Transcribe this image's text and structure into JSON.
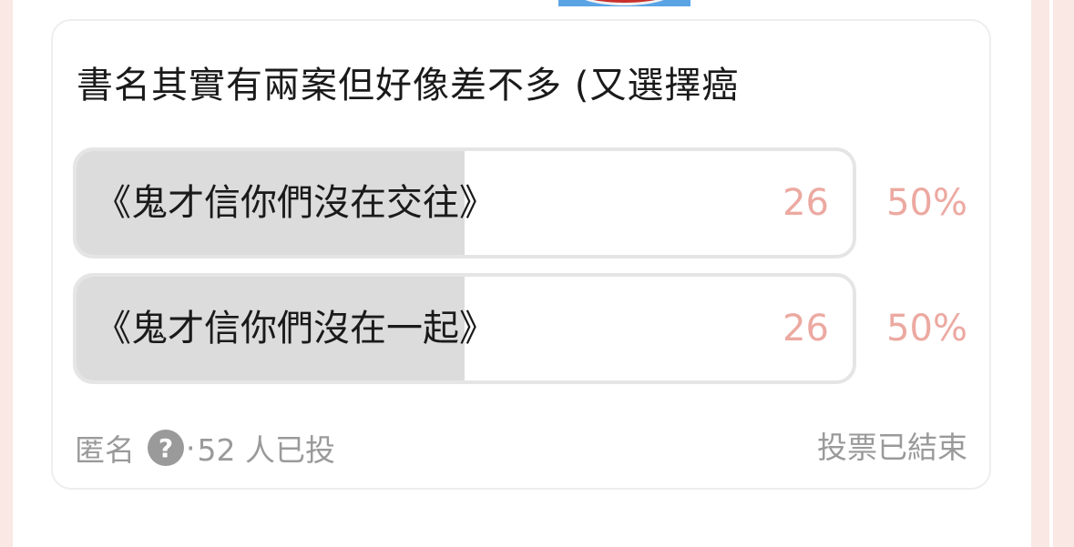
{
  "poll": {
    "question": "書名其實有兩案但好像差不多 (又選擇癌",
    "options": [
      {
        "label": "《鬼才信你們沒在交往》",
        "votes": "26",
        "percent": "50%",
        "fraction": 0.5
      },
      {
        "label": "《鬼才信你們沒在一起》",
        "votes": "26",
        "percent": "50%",
        "fraction": 0.5
      }
    ],
    "footer": {
      "anonymous_label": "匿名",
      "help_icon": "question-mark-icon",
      "help_glyph": "?",
      "separator": "·",
      "voter_count": "52 人已投",
      "status": "投票已結束"
    }
  },
  "colors": {
    "bar_fill": "#dcdcdc",
    "result_text": "#eca9a1",
    "muted_text": "#9a9a9a",
    "page_gutter": "#f9e8e4",
    "avatar_bg": "#5aa4e6"
  }
}
